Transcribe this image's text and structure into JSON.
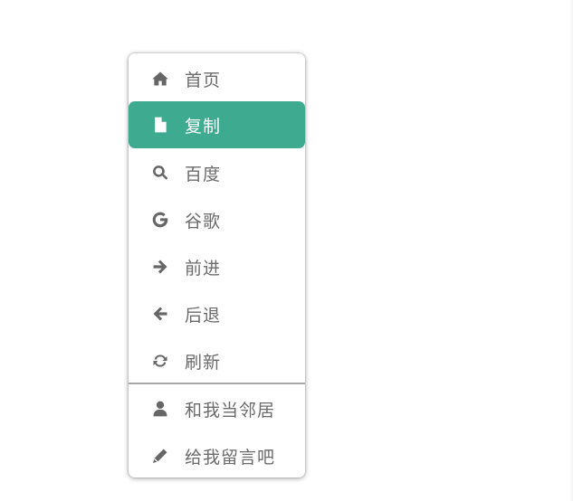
{
  "menu": {
    "items": [
      {
        "label": "首页",
        "icon": "home-icon"
      },
      {
        "label": "复制",
        "icon": "file-icon",
        "active": true
      },
      {
        "label": "百度",
        "icon": "search-icon"
      },
      {
        "label": "谷歌",
        "icon": "google-icon"
      },
      {
        "label": "前进",
        "icon": "arrow-right-icon"
      },
      {
        "label": "后退",
        "icon": "arrow-left-icon"
      },
      {
        "label": "刷新",
        "icon": "refresh-icon"
      },
      {
        "label": "和我当邻居",
        "icon": "user-icon"
      },
      {
        "label": "给我留言吧",
        "icon": "pencil-icon"
      }
    ]
  },
  "colors": {
    "active_background": "#3eaa8f",
    "icon": "#666666",
    "text": "#6b6b6b",
    "divider": "#a8a8a8"
  }
}
